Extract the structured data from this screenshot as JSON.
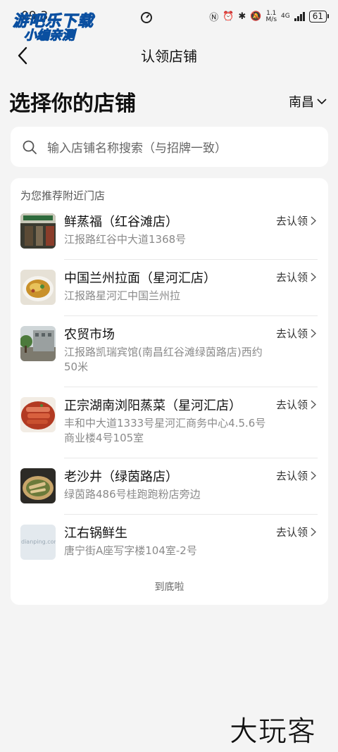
{
  "status_bar": {
    "time": "09:3",
    "net_speed": "1.1",
    "net_unit": "M/s",
    "signal": "4G",
    "battery": "61"
  },
  "watermark": {
    "line1": "游吧乐下载",
    "line2": "小编亲测"
  },
  "nav": {
    "title": "认领店铺"
  },
  "header": {
    "title": "选择你的店铺",
    "city": "南昌"
  },
  "search": {
    "placeholder": "输入店铺名称搜索（与招牌一致）"
  },
  "list": {
    "heading": "为您推荐附近门店",
    "claim_label": "去认领",
    "items": [
      {
        "name": "鲜蒸福（红谷滩店）",
        "address": "江报路红谷中大道1368号",
        "thumb": "storefront-photo"
      },
      {
        "name": "中国兰州拉面（星河汇店）",
        "address": "江报路星河汇中国兰州拉",
        "thumb": "noodle-photo"
      },
      {
        "name": "农贸市场",
        "address": "江报路凯瑞宾馆(南昌红谷滩绿茵路店)西约50米",
        "thumb": "market-photo"
      },
      {
        "name": "正宗湖南浏阳蒸菜（星河汇店）",
        "address": "丰和中大道1333号星河汇商务中心4.5.6号商业楼4号105室",
        "thumb": "meat-dish-photo"
      },
      {
        "name": "老沙井（绿茵路店）",
        "address": "绿茵路486号桂跑跑粉店旁边",
        "thumb": "fish-dish-photo"
      },
      {
        "name": "江右锅鲜生",
        "address": "唐宁街A座写字楼104室-2号",
        "thumb": "placeholder-photo",
        "thumb_text": "dianping.com"
      }
    ],
    "end_text": "到底啦"
  },
  "brand_watermark": "大玩客",
  "colors": {
    "background": "#f4f4f4",
    "card": "#ffffff",
    "secondary_text": "#8a8a8a"
  }
}
